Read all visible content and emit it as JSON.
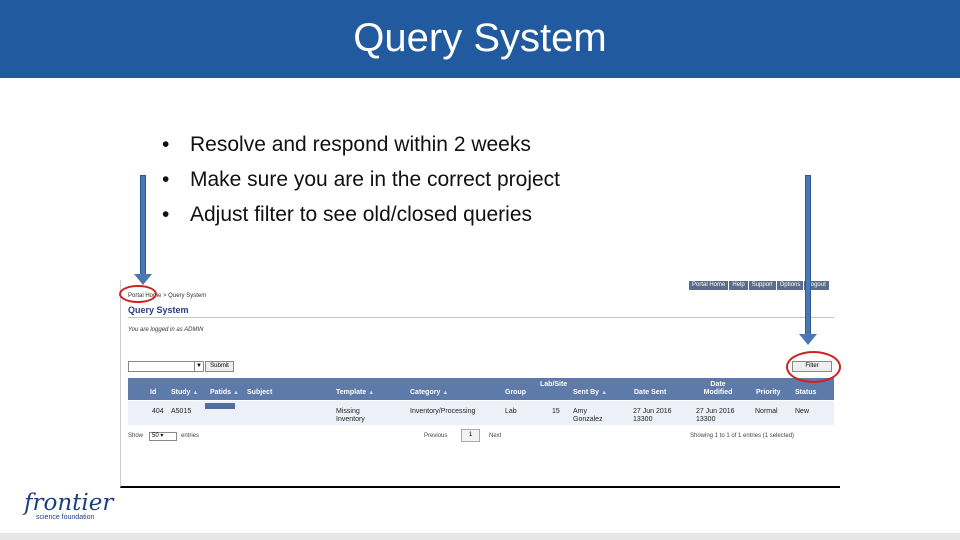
{
  "slide": {
    "title": "Query System",
    "bullets": [
      "Resolve and respond within 2 weeks",
      "Make sure you are in the correct project",
      "Adjust filter to see old/closed queries"
    ]
  },
  "app": {
    "top_nav": [
      "Portal Home",
      "Help",
      "Support",
      "Options",
      "Logout"
    ],
    "breadcrumb": "Portal Home > Query System",
    "title": "Query System",
    "login_text": "You are logged in as ADMIN",
    "submit_label": "Submit",
    "filter_label": "Filter",
    "table": {
      "columns": [
        "Id",
        "Study",
        "Patids",
        "Subject",
        "Template",
        "Category",
        "Group",
        "Lab/Site",
        "Sent By",
        "Date Sent",
        "Date Modified",
        "Priority",
        "Status"
      ],
      "rows": [
        {
          "id": "404",
          "study": "A5015",
          "patids": "",
          "subject": "",
          "template": "Missing Inventory",
          "category": "Inventory/Processing",
          "group": "Lab",
          "lab_site": "15",
          "sent_by": "Amy Gonzalez",
          "date_sent": "27 Jun 2016 13300",
          "date_modified": "27 Jun 2016 13300",
          "priority": "Normal",
          "status": "New"
        }
      ]
    },
    "footer": {
      "show_label": "Show",
      "show_value": "50",
      "entries_label": "entries",
      "previous": "Previous",
      "page": "1",
      "next": "Next",
      "summary": "Showing 1 to 1 of 1 entries (1 selected)"
    }
  },
  "logo": {
    "main": "frontier",
    "sub": "science foundation"
  },
  "colors": {
    "title_bar": "#215a9e",
    "arrow": "#4b78b5",
    "highlight_circle": "#cc2222",
    "table_header": "#5d7aa8"
  }
}
